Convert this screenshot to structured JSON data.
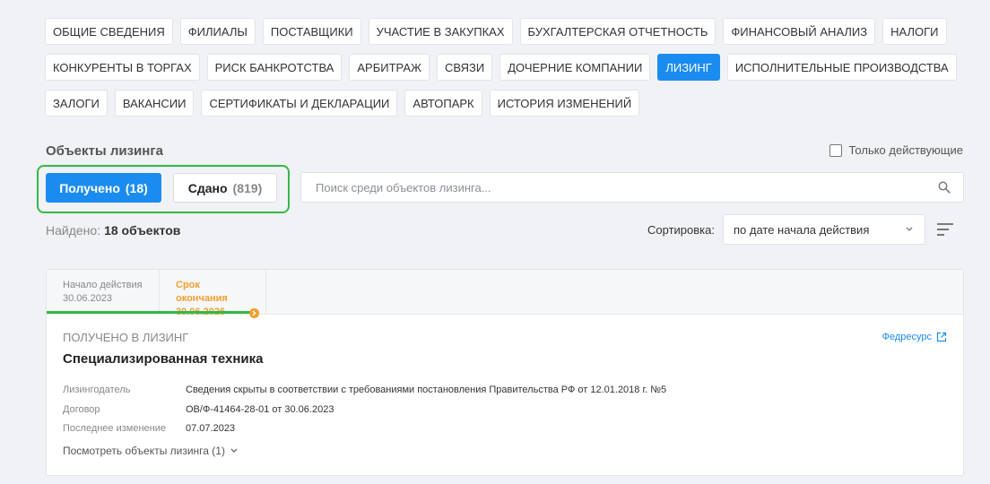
{
  "tabs": [
    [
      {
        "label": "ОБЩИЕ СВЕДЕНИЯ"
      },
      {
        "label": "ФИЛИАЛЫ"
      },
      {
        "label": "ПОСТАВЩИКИ"
      },
      {
        "label": "УЧАСТИЕ В ЗАКУПКАХ"
      },
      {
        "label": "БУХГАЛТЕРСКАЯ ОТЧЕТНОСТЬ"
      },
      {
        "label": "ФИНАНСОВЫЙ АНАЛИЗ"
      },
      {
        "label": "НАЛОГИ"
      }
    ],
    [
      {
        "label": "КОНКУРЕНТЫ В ТОРГАХ"
      },
      {
        "label": "РИСК БАНКРОТСТВА"
      },
      {
        "label": "АРБИТРАЖ"
      },
      {
        "label": "СВЯЗИ"
      },
      {
        "label": "ДОЧЕРНИЕ КОМПАНИИ"
      },
      {
        "label": "ЛИЗИНГ",
        "active": true
      },
      {
        "label": "ИСПОЛНИТЕЛЬНЫЕ ПРОИЗВОДСТВА"
      }
    ],
    [
      {
        "label": "ЗАЛОГИ"
      },
      {
        "label": "ВАКАНСИИ"
      },
      {
        "label": "СЕРТИФИКАТЫ И ДЕКЛАРАЦИИ"
      },
      {
        "label": "АВТОПАРК"
      },
      {
        "label": "ИСТОРИЯ ИЗМЕНЕНИЙ"
      }
    ]
  ],
  "section": {
    "title": "Объекты лизинга",
    "only_active_label": "Только действующие"
  },
  "toggle": {
    "received_label": "Получено",
    "received_count": "(18)",
    "given_label": "Сдано",
    "given_count": "(819)"
  },
  "search": {
    "placeholder": "Поиск среди объектов лизинга..."
  },
  "results": {
    "found_label": "Найдено:",
    "found_value": "18 объектов"
  },
  "sort": {
    "label": "Сортировка:",
    "value": "по дате начала действия"
  },
  "card": {
    "tab_start_label": "Начало действия",
    "tab_start_date": "30.06.2023",
    "tab_end_label": "Срок окончания",
    "tab_end_date": "30.06.2026",
    "subtitle": "ПОЛУЧЕНО В ЛИЗИНГ",
    "link": "Федресурс",
    "title": "Специализированная техника",
    "rows": [
      {
        "key": "Лизингодатель",
        "value": "Сведения скрыты в соответствии с требованиями постановления Правительства РФ от 12.01.2018 г. №5"
      },
      {
        "key": "Договор",
        "value": "ОВ/Ф-41464-28-01 от 30.06.2023"
      },
      {
        "key": "Последнее изменение",
        "value": "07.07.2023"
      }
    ],
    "view_more": "Посмотреть объекты лизинга (1)"
  },
  "colors": {
    "accent": "#1a8cf0",
    "highlight": "#35b84a",
    "orange": "#f0a030"
  }
}
